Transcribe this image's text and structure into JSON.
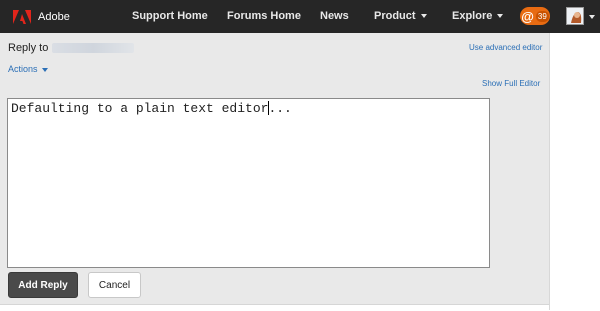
{
  "brand": {
    "name": "Adobe"
  },
  "nav": [
    {
      "label": "Support Home"
    },
    {
      "label": "Forums Home"
    },
    {
      "label": "News"
    },
    {
      "label": "Product"
    },
    {
      "label": "Explore"
    }
  ],
  "notifications": {
    "symbol": "@",
    "count": "39"
  },
  "reply": {
    "prefix": "Reply to"
  },
  "links": {
    "use_advanced_editor": "Use advanced editor",
    "actions": "Actions",
    "show_full_editor": "Show Full Editor"
  },
  "editor": {
    "value": "Defaulting to a plain text editor..."
  },
  "buttons": {
    "add_reply": "Add Reply",
    "cancel": "Cancel"
  },
  "colors": {
    "topbar": "#262626",
    "accent": "#e86b12",
    "link": "#2b6fb6",
    "primary_button": "#4a4a4a"
  }
}
